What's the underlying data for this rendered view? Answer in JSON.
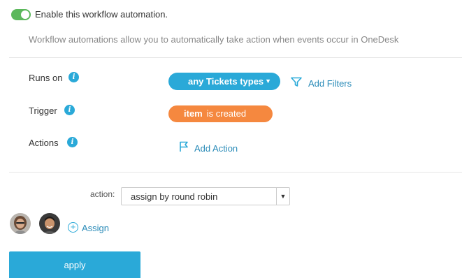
{
  "enable": {
    "label": "Enable this workflow automation.",
    "on": true
  },
  "description": "Workflow automations allow you to automatically take action when events occur in OneDesk",
  "rows": {
    "runs_on": "Runs on",
    "trigger": "Trigger",
    "actions": "Actions"
  },
  "runs_on_pill": {
    "text": "any Tickets types",
    "color": "#2aa9d8"
  },
  "add_filters": "Add Filters",
  "trigger_pill": {
    "subject": "item",
    "event": "is created",
    "color": "#f5883f"
  },
  "add_action": "Add Action",
  "action_select": {
    "label": "action:",
    "value": "assign by round robin"
  },
  "assign_link": "Assign",
  "apply_label": "apply",
  "colors": {
    "accent": "#2aa9d8",
    "toggle_on": "#5cb85c",
    "trigger": "#f5883f"
  }
}
